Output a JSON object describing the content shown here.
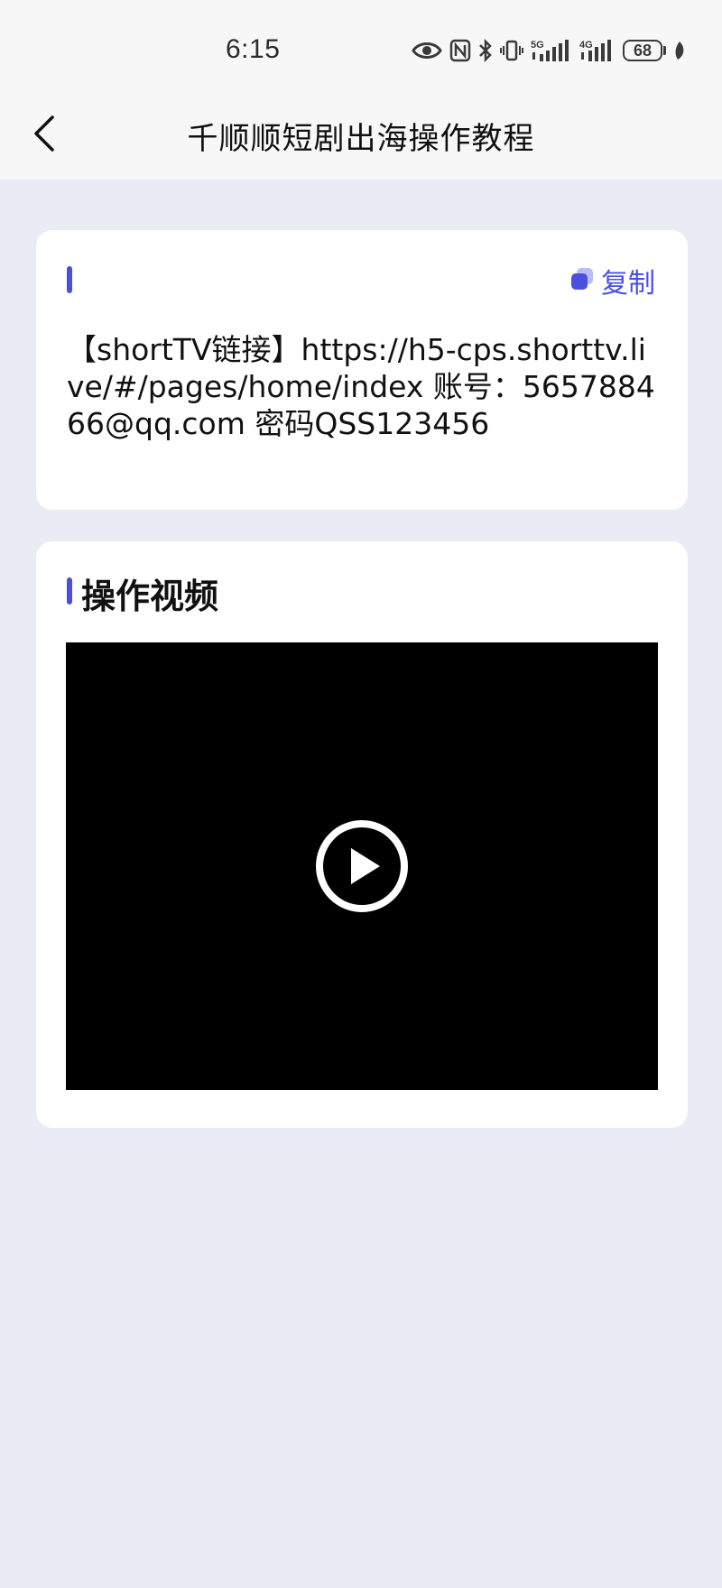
{
  "status_bar": {
    "time": "6:15",
    "battery_level": "68",
    "icons": [
      "eye-icon",
      "nfc-icon",
      "bluetooth-icon",
      "vibrate-icon",
      "5g-signal-icon",
      "4g-signal-icon",
      "battery-icon",
      "leaf-icon"
    ]
  },
  "nav": {
    "title": "千顺顺短剧出海操作教程",
    "back_icon": "chevron-left-icon"
  },
  "info_card": {
    "copy_label": "复制",
    "copy_icon": "copy-icon",
    "content": "【shortTV链接】https://h5-cps.shorttv.live/#/pages/home/index 账号：565788466@qq.com 密码QSS123456"
  },
  "video_card": {
    "title": "操作视频",
    "play_icon": "play-circle-icon"
  },
  "colors": {
    "accent": "#4a4fe0",
    "background": "#e9ecf5",
    "card": "#ffffff",
    "video_bg": "#000000"
  }
}
